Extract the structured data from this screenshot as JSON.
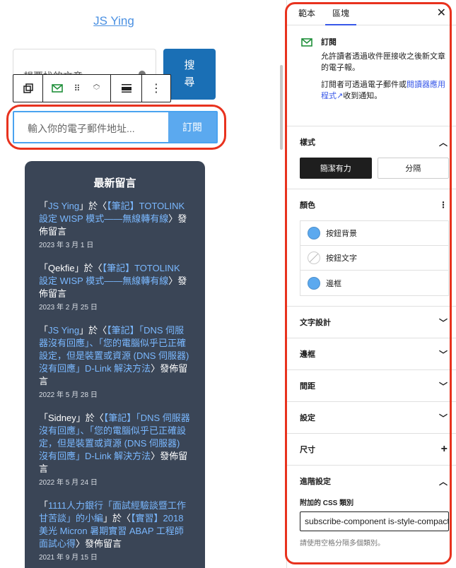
{
  "site": {
    "title": "JS Ying"
  },
  "search": {
    "placeholder": "想要找的文章",
    "button_label": "搜尋"
  },
  "subscribe": {
    "placeholder": "輸入你的電子郵件地址...",
    "button_label": "訂閱"
  },
  "comments": {
    "heading": "最新留言",
    "items": [
      {
        "prefix": "「",
        "author": "JS Ying",
        "mid": "」於〈",
        "post": "【筆記】TOTOLINK 設定 WISP 模式——無線轉有線",
        "suffix": "〉發佈留言",
        "date": "2023 年 3 月 1 日"
      },
      {
        "prefix": "「Qekfie」於〈",
        "author": "",
        "mid": "",
        "post": "【筆記】TOTOLINK 設定 WISP 模式——無線轉有線",
        "suffix": "〉發佈留言",
        "date": "2023 年 2 月 25 日"
      },
      {
        "prefix": "「",
        "author": "JS Ying",
        "mid": "」於〈",
        "post": "【筆記】「DNS 伺服器沒有回應」、「您的電腦似乎已正確設定，但是裝置或資源 (DNS 伺服器) 沒有回應」D-Link 解決方法",
        "suffix": "〉發佈留言",
        "date": "2022 年 5 月 28 日"
      },
      {
        "prefix": "「Sidney」於〈",
        "author": "",
        "mid": "",
        "post": "【筆記】「DNS 伺服器沒有回應」、「您的電腦似乎已正確設定，但是裝置或資源 (DNS 伺服器) 沒有回應」D-Link 解決方法",
        "suffix": "〉發佈留言",
        "date": "2022 年 5 月 24 日"
      },
      {
        "prefix": "「",
        "author": "1111人力銀行「面試經驗談暨工作甘苦談」的小編",
        "mid": "」於〈",
        "post": "【實習】2018 美光 Micron 暑期實習 ABAP 工程師面試心得",
        "suffix": "〉發佈留言",
        "date": "2021 年 9 月 15 日"
      }
    ]
  },
  "panel": {
    "tabs": [
      "範本",
      "區塊"
    ],
    "block": {
      "name": "訂閱",
      "desc": "允許讀者透過收件匣接收之後新文章的電子報。",
      "note_pre": "訂閱者可透過電子郵件或",
      "note_link": "閱讀器應用程式",
      "note_post": "收到通知。"
    },
    "styles": {
      "title": "樣式",
      "options": [
        "簡潔有力",
        "分隔"
      ]
    },
    "colors": {
      "title": "顏色",
      "items": [
        {
          "label": "按鈕背景",
          "color": "#5ba9ef"
        },
        {
          "label": "按鈕文字",
          "color": ""
        },
        {
          "label": "邊框",
          "color": "#5ba9ef"
        }
      ]
    },
    "sections": [
      "文字設計",
      "邊框",
      "間距",
      "設定",
      "尺寸"
    ],
    "advanced": {
      "title": "進階設定",
      "css_label": "附加的 CSS 類別",
      "css_value": "subscribe-component is-style-compact",
      "help": "請使用空格分隔多個類別。"
    }
  }
}
